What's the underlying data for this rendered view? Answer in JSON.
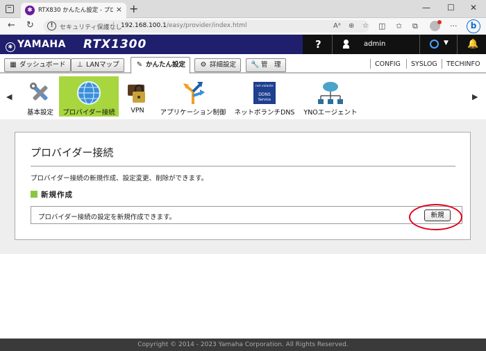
{
  "browser": {
    "tab_title": "RTX830 かんたん設定 - プロバイダー接",
    "tab_close": "×",
    "new_tab": "+",
    "window_controls": {
      "minimize": "—",
      "maximize": "☐",
      "close": "✕"
    },
    "security_text": "セキュリティ保護なし",
    "url_host": "192.168.100.1",
    "url_path": "/easy/provider/index.html"
  },
  "header": {
    "brand": "YAMAHA",
    "model": "RTX1300",
    "help": "?",
    "username": "admin"
  },
  "menu": {
    "items": [
      {
        "label": "ダッシュボード",
        "icon": "dashboard-icon",
        "glyph": "▦"
      },
      {
        "label": "LANマップ",
        "icon": "lanmap-icon",
        "glyph": "⊥"
      },
      {
        "label": "かんたん設定",
        "icon": "easy-setup-icon",
        "glyph": "✎",
        "active": true
      },
      {
        "label": "詳細設定",
        "icon": "gear-icon",
        "glyph": "⚙"
      },
      {
        "label": "管　理",
        "icon": "wrench-icon",
        "glyph": "🔧"
      }
    ],
    "links": [
      "CONFIG",
      "SYSLOG",
      "TECHINFO"
    ]
  },
  "submenu": {
    "prev": "◀",
    "next": "▶",
    "items": [
      {
        "label": "基本設定",
        "icon": "basic-settings-icon"
      },
      {
        "label": "プロバイダー接続",
        "icon": "globe-icon",
        "active": true
      },
      {
        "label": "VPN",
        "icon": "vpn-icon"
      },
      {
        "label": "アプリケーション制御",
        "icon": "app-control-icon"
      },
      {
        "label": "ネットボランチDNS",
        "icon": "ddns-icon",
        "badge_top": "net volante",
        "badge_bottom": "DDNS Service"
      },
      {
        "label": "YNOエージェント",
        "icon": "yno-agent-icon"
      }
    ]
  },
  "panel": {
    "title": "プロバイダー接続",
    "description": "プロバイダー接続の新規作成、設定変更、削除ができます。",
    "section_title": "新規作成",
    "row_text": "プロバイダー接続の設定を新規作成できます。",
    "new_button": "新規"
  },
  "footer": {
    "copyright": "Copyright © 2014 - 2023 Yamaha Corporation. All Rights Reserved."
  }
}
